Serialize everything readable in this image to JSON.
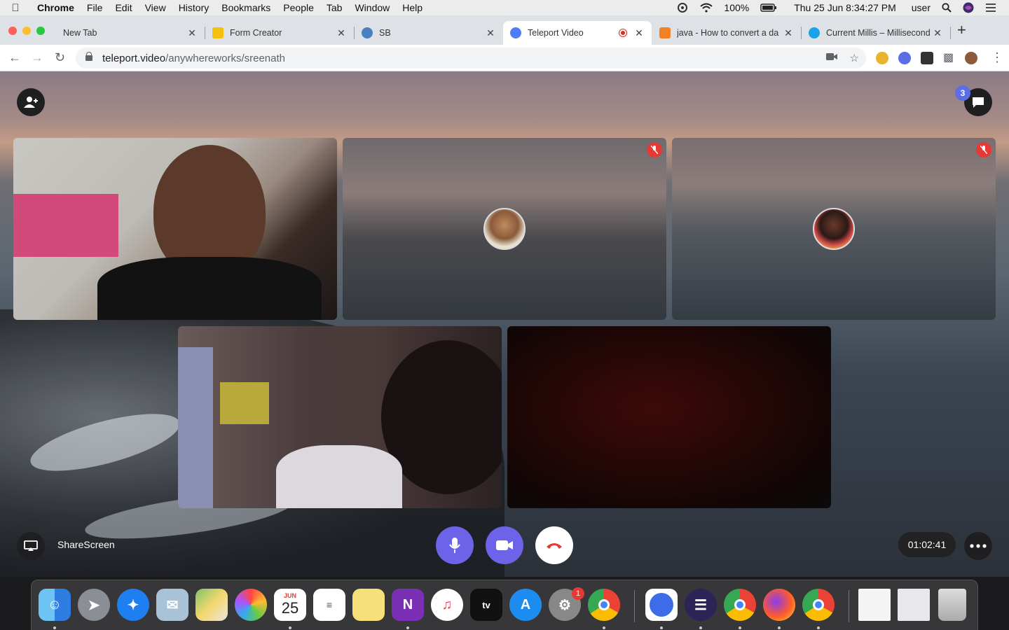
{
  "menubar": {
    "app_name": "Chrome",
    "menus": [
      "File",
      "Edit",
      "View",
      "History",
      "Bookmarks",
      "People",
      "Tab",
      "Window",
      "Help"
    ],
    "battery": "100%",
    "datetime": "Thu 25 Jun  8:34:27 PM",
    "user": "user"
  },
  "tabs": [
    {
      "title": "New Tab",
      "favicon_color": "#dee1e6"
    },
    {
      "title": "Form Creator",
      "favicon_color": "#f4c20d"
    },
    {
      "title": "SB",
      "favicon_color": "#4a7fc1"
    },
    {
      "title": "Teleport Video",
      "favicon_color": "#4f7df9"
    },
    {
      "title": "java - How to convert a da",
      "favicon_color": "#f48024"
    },
    {
      "title": "Current Millis – Millisecond",
      "favicon_color": "#1aa3e8"
    }
  ],
  "toolbar": {
    "url_host": "teleport.video",
    "url_path": "/anywhereworks/sreenath"
  },
  "call": {
    "participants_badge": "3",
    "share_screen_label": "ShareScreen",
    "timer": "01:02:41",
    "muted_icon": "mic-off-icon",
    "colors": {
      "mic": "#6c63e8",
      "camera": "#6c63e8",
      "hangup": "#ffffff",
      "hangup_icon": "#e53935",
      "muted": "#e53935"
    }
  },
  "dock": {
    "calendar_month": "JUN",
    "calendar_day": "25",
    "settings_badge": "1",
    "apps": [
      "finder",
      "launchpad",
      "safari",
      "mail",
      "maps",
      "photos",
      "calendar",
      "reminders",
      "notes",
      "onenote",
      "music",
      "tv",
      "app-store",
      "system-preferences",
      "chrome",
      "chrome-canary",
      "eclipse",
      "chrome",
      "firefox",
      "chrome",
      "calendar-doc",
      "preview-doc",
      "trash"
    ]
  }
}
